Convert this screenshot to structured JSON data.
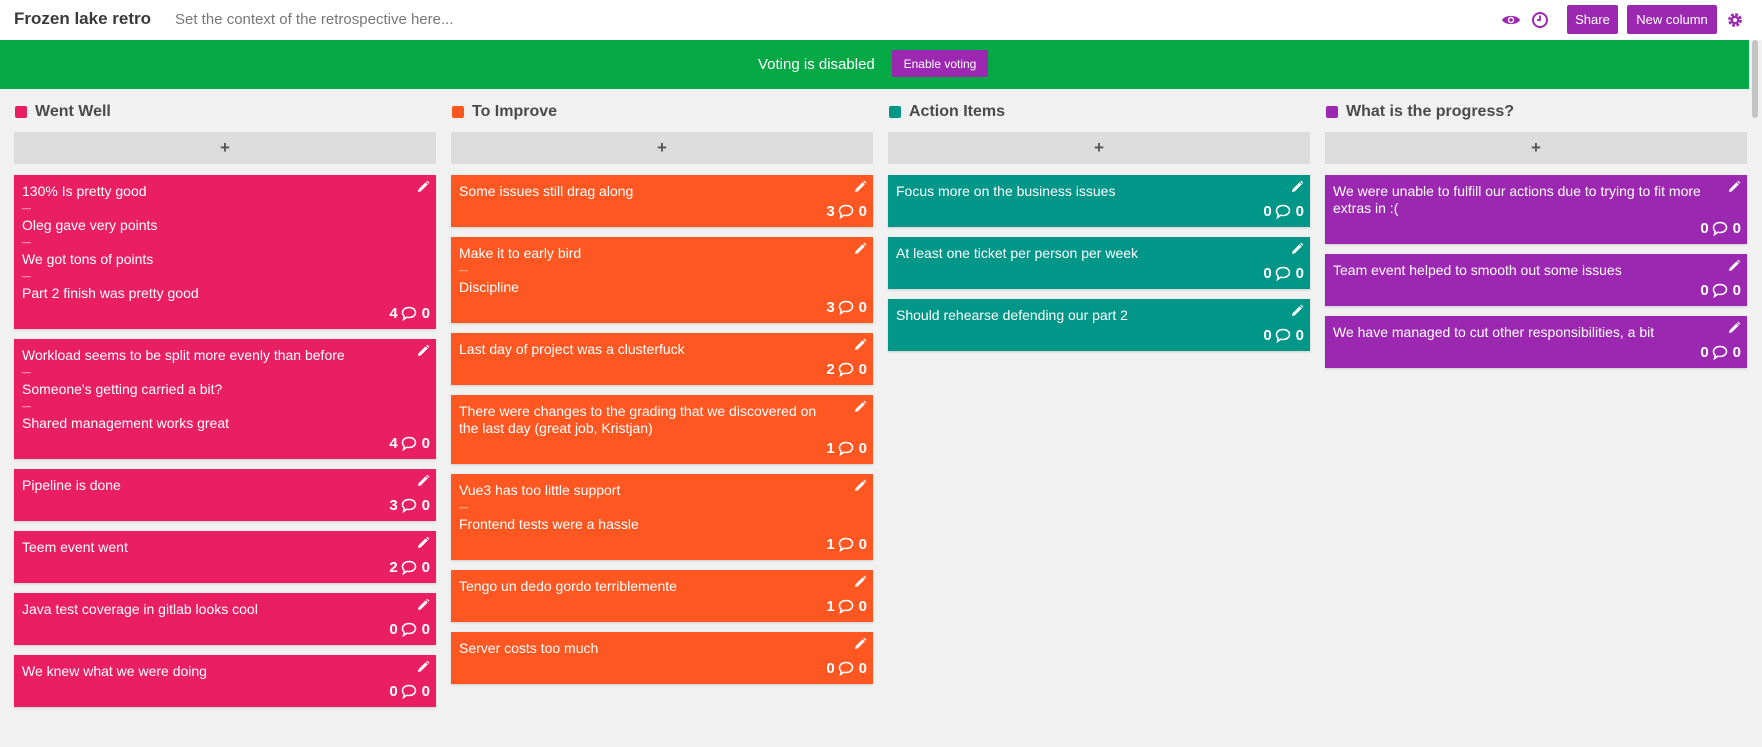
{
  "header": {
    "title": "Frozen lake retro",
    "context_placeholder": "Set the context of the retrospective here...",
    "share_label": "Share",
    "new_column_label": "New column",
    "accent_color": "#9c27b0",
    "icons": [
      "eye-icon",
      "clock-icon",
      "gear-icon"
    ]
  },
  "voting": {
    "status_text": "Voting is disabled",
    "button_label": "Enable voting",
    "bar_color": "#04a844"
  },
  "columns": [
    {
      "title": "Went Well",
      "color": "#e91e63",
      "add_label": "+",
      "cards": [
        {
          "lines": [
            "130% Is pretty good",
            "Oleg gave very points",
            "We got tons of points",
            "Part 2 finish was pretty good"
          ],
          "votes": "4",
          "comments": "0"
        },
        {
          "lines": [
            "Workload seems to be split more evenly than before",
            "Someone's getting carried a bit?",
            "Shared management works great"
          ],
          "votes": "4",
          "comments": "0"
        },
        {
          "lines": [
            "Pipeline is done"
          ],
          "votes": "3",
          "comments": "0"
        },
        {
          "lines": [
            "Teem event went"
          ],
          "votes": "2",
          "comments": "0"
        },
        {
          "lines": [
            "Java test coverage in gitlab looks cool"
          ],
          "votes": "0",
          "comments": "0"
        },
        {
          "lines": [
            "We knew what we were doing"
          ],
          "votes": "0",
          "comments": "0"
        }
      ]
    },
    {
      "title": "To Improve",
      "color": "#ff5722",
      "add_label": "+",
      "cards": [
        {
          "lines": [
            "Some issues still drag along"
          ],
          "votes": "3",
          "comments": "0"
        },
        {
          "lines": [
            "Make it to early bird",
            "Discipline"
          ],
          "votes": "3",
          "comments": "0"
        },
        {
          "lines": [
            "Last day of project was a clusterfuck"
          ],
          "votes": "2",
          "comments": "0"
        },
        {
          "lines": [
            "There were changes to the grading that we discovered on the last day (great job, Kristjan)"
          ],
          "votes": "1",
          "comments": "0"
        },
        {
          "lines": [
            "Vue3 has too little support",
            "Frontend tests were a hassle"
          ],
          "votes": "1",
          "comments": "0"
        },
        {
          "lines": [
            "Tengo un dedo gordo terriblemente"
          ],
          "votes": "1",
          "comments": "0"
        },
        {
          "lines": [
            "Server costs too much"
          ],
          "votes": "0",
          "comments": "0"
        }
      ]
    },
    {
      "title": "Action Items",
      "color": "#009688",
      "add_label": "+",
      "cards": [
        {
          "lines": [
            "Focus more on the business issues"
          ],
          "votes": "0",
          "comments": "0"
        },
        {
          "lines": [
            "At least one ticket per person per week"
          ],
          "votes": "0",
          "comments": "0"
        },
        {
          "lines": [
            "Should rehearse defending our part 2"
          ],
          "votes": "0",
          "comments": "0"
        }
      ]
    },
    {
      "title": "What is the progress?",
      "color": "#9c27b0",
      "add_label": "+",
      "cards": [
        {
          "lines": [
            "We were unable to fulfill our actions due to trying to fit more extras in :("
          ],
          "votes": "0",
          "comments": "0"
        },
        {
          "lines": [
            "Team event helped to smooth out some issues"
          ],
          "votes": "0",
          "comments": "0"
        },
        {
          "lines": [
            "We have managed to cut other responsibilities, a bit"
          ],
          "votes": "0",
          "comments": "0"
        }
      ]
    }
  ]
}
